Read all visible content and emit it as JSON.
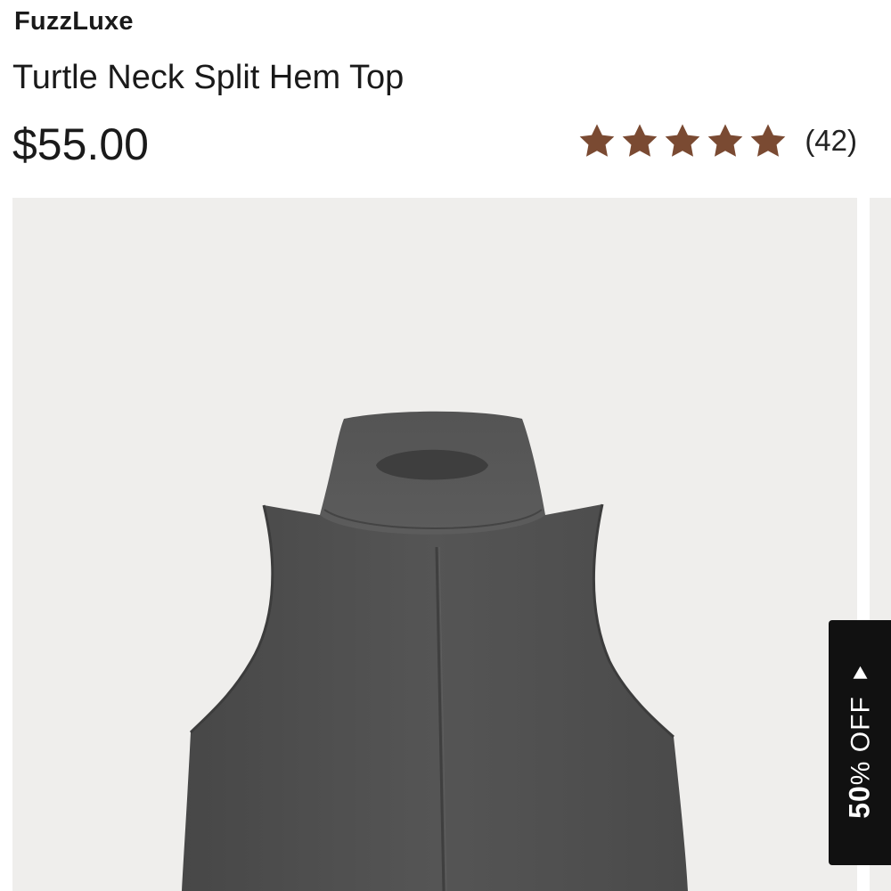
{
  "product": {
    "brand": "FuzzLuxe",
    "title": "Turtle Neck Split Hem Top",
    "price": "$55.00"
  },
  "rating": {
    "stars": 5,
    "max_stars": 5,
    "review_count": "(42)",
    "star_color": "#7a4a32"
  },
  "gallery": {
    "image_subject": "gray sleeveless turtleneck top",
    "background_color": "#efeeec",
    "garment_color": "#505050"
  },
  "promo": {
    "percent": "50",
    "suffix": "% OFF",
    "arrow_icon": "triangle-up-icon"
  }
}
